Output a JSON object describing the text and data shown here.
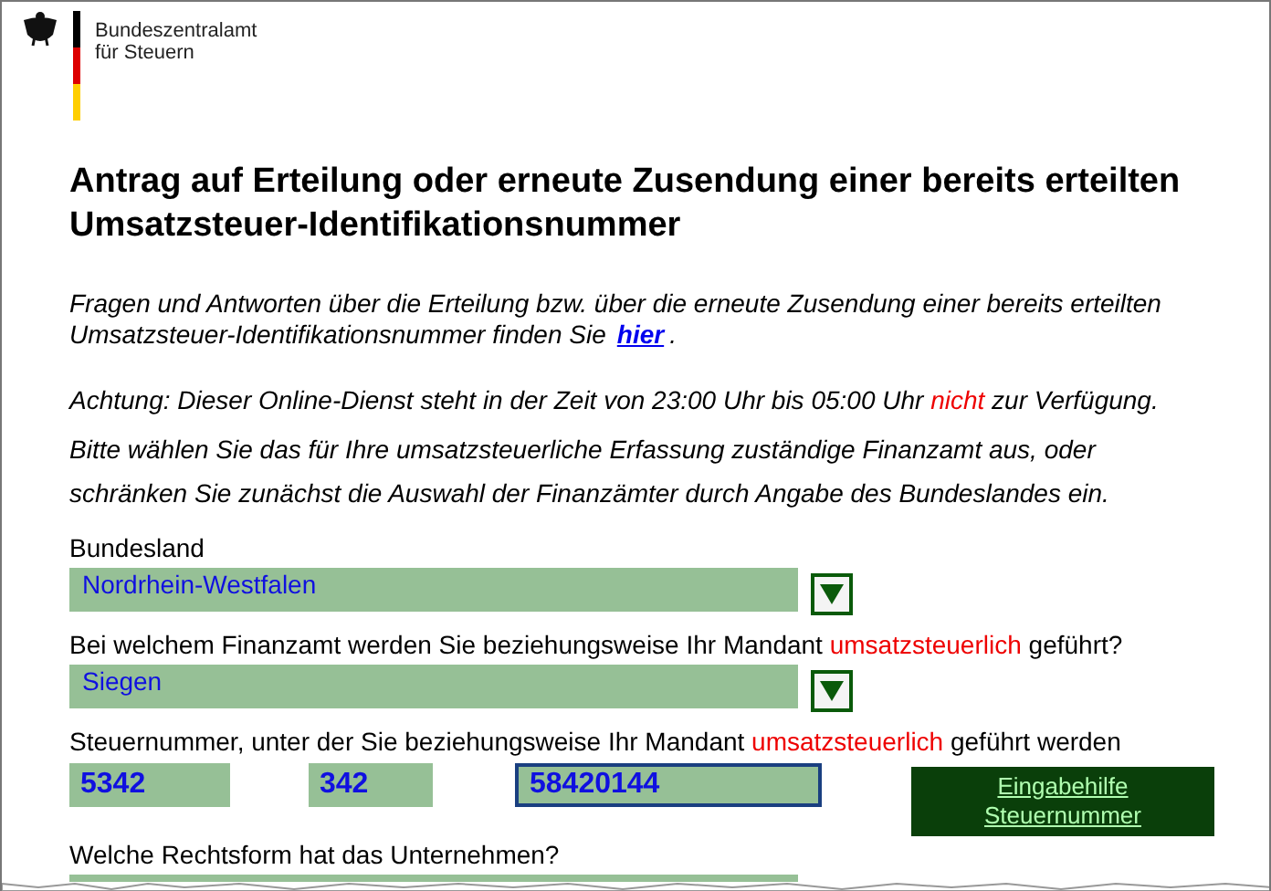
{
  "header": {
    "agency_lines": [
      "Bundeszentralamt",
      "für Steuern"
    ]
  },
  "title": "Antrag auf Erteilung oder erneute Zusendung einer bereits erteilten Umsatzsteuer-Identifikationsnummer",
  "faq": {
    "text": "Fragen und Antworten über die Erteilung bzw. über die erneute Zusendung einer bereits erteilten Umsatzsteuer-Identifikationsnummer finden Sie",
    "link": "hier",
    "end": "."
  },
  "notice": [
    {
      "text": "Achtung: Dieser Online-Dienst steht in der Zeit von 23:00 Uhr bis 05:00 Uhr",
      "highlight": false
    },
    {
      "text": "nicht",
      "highlight": true
    },
    {
      "text": "zur Verfügung.",
      "highlight": false
    }
  ],
  "instruction": "Bitte wählen Sie das für Ihre umsatzsteuerliche Erfassung zuständige Finanzamt aus, oder schränken Sie zunächst die Auswahl der Finanzämter durch Angabe des Bundeslandes ein.",
  "fields": [
    {
      "kind": "select",
      "label": [
        {
          "text": "Bundesland",
          "highlight": false
        }
      ],
      "value": "Nordrhein-Westfalen"
    },
    {
      "kind": "select",
      "label": [
        {
          "text": "Bei welchem Finanzamt werden Sie beziehungsweise Ihr Mandant",
          "highlight": false
        },
        {
          "text": "umsatzsteuerlich",
          "highlight": true
        },
        {
          "text": "geführt?",
          "highlight": false
        }
      ],
      "value": "Siegen"
    },
    {
      "kind": "taxnumber",
      "label": [
        {
          "text": "Steuernummer, unter der Sie beziehungsweise Ihr Mandant",
          "highlight": false
        },
        {
          "text": "umsatzsteuerlich",
          "highlight": true
        },
        {
          "text": "geführt werden",
          "highlight": false
        }
      ],
      "segments": [
        {
          "value": "5342",
          "focused": false
        },
        {
          "value": "342",
          "focused": false
        },
        {
          "value": "58420144",
          "focused": true
        }
      ],
      "help_button": [
        "Eingabehilfe",
        "Steuernummer"
      ]
    },
    {
      "kind": "select_cut",
      "label": [
        {
          "text": "Welche Rechtsform hat das Unternehmen?",
          "highlight": false
        }
      ]
    }
  ]
}
